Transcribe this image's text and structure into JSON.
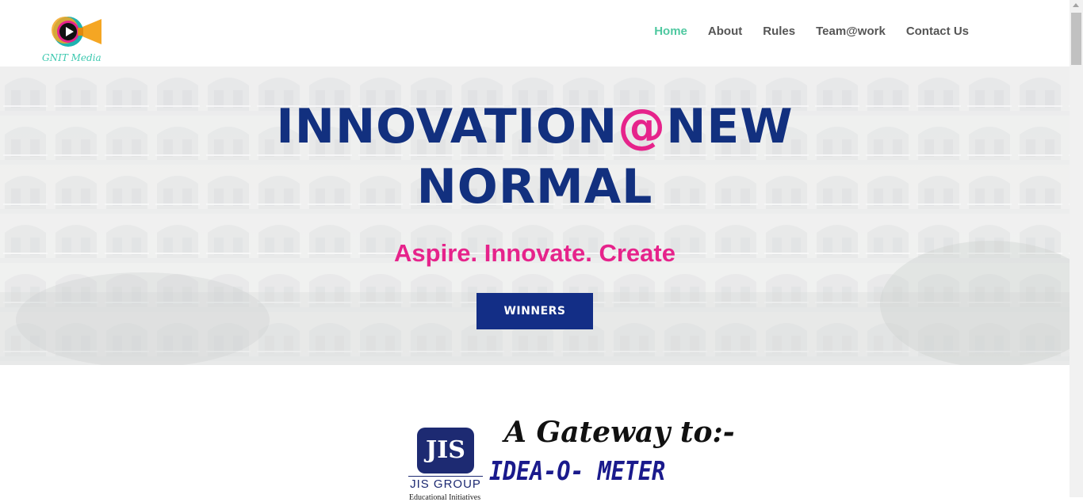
{
  "header": {
    "logo_caption": "GNIT Media",
    "nav": [
      {
        "label": "Home",
        "active": true
      },
      {
        "label": "About",
        "active": false
      },
      {
        "label": "Rules",
        "active": false
      },
      {
        "label": "Team@work",
        "active": false
      },
      {
        "label": "Contact Us",
        "active": false
      }
    ]
  },
  "hero": {
    "title_part1": "INNOVATION",
    "title_at": "@",
    "title_part2": "NEW",
    "title_line2": "NORMAL",
    "tagline": "Aspire. Innovate. Create",
    "button_label": "WINNERS"
  },
  "sponsor": {
    "jis_logo_text": "JIS",
    "jis_group": "JIS GROUP",
    "jis_subtitle": "Educational Initiatives",
    "gateway_text": "A Gateway to:-",
    "idea_meter": "IDEA-O- METER"
  },
  "colors": {
    "nav_active": "#4fc8a0",
    "nav_text": "#555555",
    "title_blue": "#12307f",
    "accent_pink": "#e6238b",
    "button_bg": "#132e86"
  }
}
